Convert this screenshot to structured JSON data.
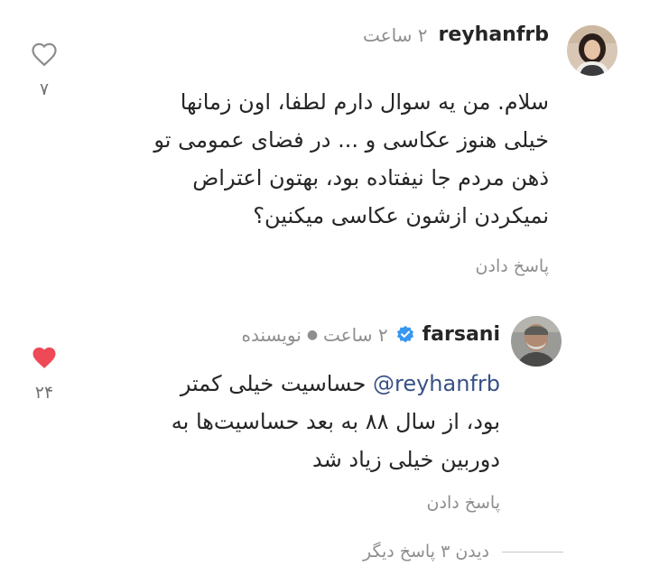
{
  "comments": [
    {
      "username": "reyhanfrb",
      "time": "۲ ساعت",
      "text_lines": [
        "سلام. من یه سوال دارم لطفا، اون زمانها",
        "خیلی هنوز عکاسی و ... در فضای عمومی تو",
        "ذهن مردم جا نیفتاده بود، بهتون اعتراض",
        "نمیکردن ازشون عکاسی میکنین؟"
      ],
      "reply_label": "پاسخ دادن",
      "like_count": "۷",
      "liked": false,
      "icon": "heart-outline-icon"
    },
    {
      "username": "farsani",
      "verified": true,
      "time": "۲ ساعت",
      "role": "نویسنده",
      "mention": "@reyhanfrb",
      "text_first": "حساسیت خیلی کمتر",
      "text_lines": [
        "بود، از سال ۸۸ به بعد حساسیت‌ها به",
        "دوربین خیلی زیاد شد"
      ],
      "reply_label": "پاسخ دادن",
      "like_count": "۲۴",
      "liked": true,
      "icon": "heart-filled-icon"
    }
  ],
  "view_replies": "دیدن ۳ پاسخ دیگر",
  "colors": {
    "text": "#262626",
    "muted": "#8e8e8e",
    "liked": "#ed4956",
    "verified": "#3897f0",
    "mention": "#385185"
  }
}
